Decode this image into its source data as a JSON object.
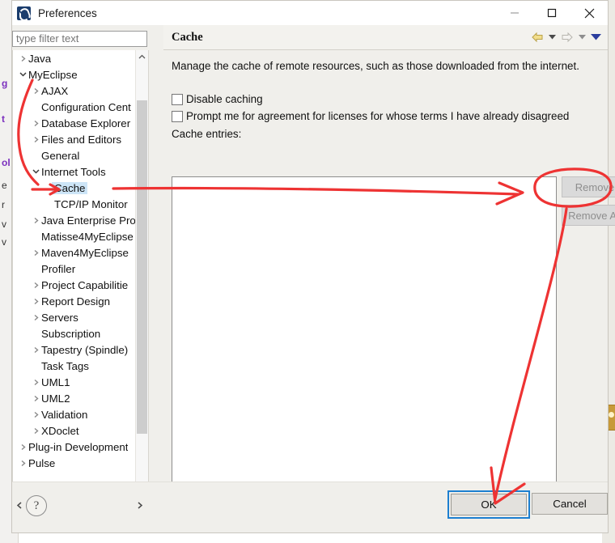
{
  "window": {
    "title": "Preferences",
    "icon": "myeclipse-icon",
    "minimize": "minimize-icon",
    "maximize": "maximize-icon",
    "close": "close-icon"
  },
  "filter": {
    "placeholder": "type filter text",
    "value": ""
  },
  "tree": {
    "items": [
      {
        "label": "Java",
        "indent": 0,
        "arrow": "collapsed",
        "selected": false
      },
      {
        "label": "MyEclipse",
        "indent": 0,
        "arrow": "expanded",
        "selected": false
      },
      {
        "label": "AJAX",
        "indent": 1,
        "arrow": "collapsed",
        "selected": false
      },
      {
        "label": "Configuration Cent",
        "indent": 1,
        "arrow": "none",
        "selected": false
      },
      {
        "label": "Database Explorer",
        "indent": 1,
        "arrow": "collapsed",
        "selected": false
      },
      {
        "label": "Files and Editors",
        "indent": 1,
        "arrow": "collapsed",
        "selected": false
      },
      {
        "label": "General",
        "indent": 1,
        "arrow": "none",
        "selected": false
      },
      {
        "label": "Internet Tools",
        "indent": 1,
        "arrow": "expanded",
        "selected": false
      },
      {
        "label": "Cache",
        "indent": 2,
        "arrow": "none",
        "selected": true
      },
      {
        "label": "TCP/IP Monitor",
        "indent": 2,
        "arrow": "none",
        "selected": false
      },
      {
        "label": "Java Enterprise Pro",
        "indent": 1,
        "arrow": "collapsed",
        "selected": false
      },
      {
        "label": "Matisse4MyEclipse",
        "indent": 1,
        "arrow": "none",
        "selected": false
      },
      {
        "label": "Maven4MyEclipse",
        "indent": 1,
        "arrow": "collapsed",
        "selected": false
      },
      {
        "label": "Profiler",
        "indent": 1,
        "arrow": "none",
        "selected": false
      },
      {
        "label": "Project Capabilitie",
        "indent": 1,
        "arrow": "collapsed",
        "selected": false
      },
      {
        "label": "Report Design",
        "indent": 1,
        "arrow": "collapsed",
        "selected": false
      },
      {
        "label": "Servers",
        "indent": 1,
        "arrow": "collapsed",
        "selected": false
      },
      {
        "label": "Subscription",
        "indent": 1,
        "arrow": "none",
        "selected": false
      },
      {
        "label": "Tapestry (Spindle)",
        "indent": 1,
        "arrow": "collapsed",
        "selected": false
      },
      {
        "label": "Task Tags",
        "indent": 1,
        "arrow": "none",
        "selected": false
      },
      {
        "label": "UML1",
        "indent": 1,
        "arrow": "collapsed",
        "selected": false
      },
      {
        "label": "UML2",
        "indent": 1,
        "arrow": "collapsed",
        "selected": false
      },
      {
        "label": "Validation",
        "indent": 1,
        "arrow": "collapsed",
        "selected": false
      },
      {
        "label": "XDoclet",
        "indent": 1,
        "arrow": "collapsed",
        "selected": false
      },
      {
        "label": "Plug-in Development",
        "indent": 0,
        "arrow": "collapsed",
        "selected": false
      },
      {
        "label": "Pulse",
        "indent": 0,
        "arrow": "collapsed",
        "selected": false
      }
    ]
  },
  "page": {
    "title": "Cache",
    "description": "Manage the cache of remote resources, such as those downloaded from the internet.",
    "checkboxes": [
      {
        "label": "Disable caching",
        "checked": false
      },
      {
        "label": "Prompt me for agreement for licenses for whose terms I have already disagreed",
        "checked": false
      }
    ],
    "entries_label": "Cache entries:",
    "entries": [],
    "buttons": [
      {
        "label": "Remove",
        "enabled": false
      },
      {
        "label": "Remove All",
        "enabled": false
      }
    ],
    "nav": {
      "back": "back-arrow-icon",
      "back_menu": "chevron-down-icon",
      "forward": "forward-arrow-icon",
      "forward_menu": "chevron-down-icon",
      "more": "chevron-down-icon"
    }
  },
  "footer": {
    "help": "?",
    "ok": "OK",
    "cancel": "Cancel"
  },
  "background": {
    "fragments": [
      "g",
      "t",
      "ol",
      "e",
      "r",
      "v",
      "v"
    ]
  },
  "annotation": {
    "color": "#ee3333",
    "marks": [
      "curve-from-myeclipse-to-cache",
      "arrow-pointing-at-cache",
      "long-horizontal-arrow-to-remove-all",
      "ellipse-around-remove-all",
      "arrow-from-remove-all-to-ok"
    ]
  }
}
